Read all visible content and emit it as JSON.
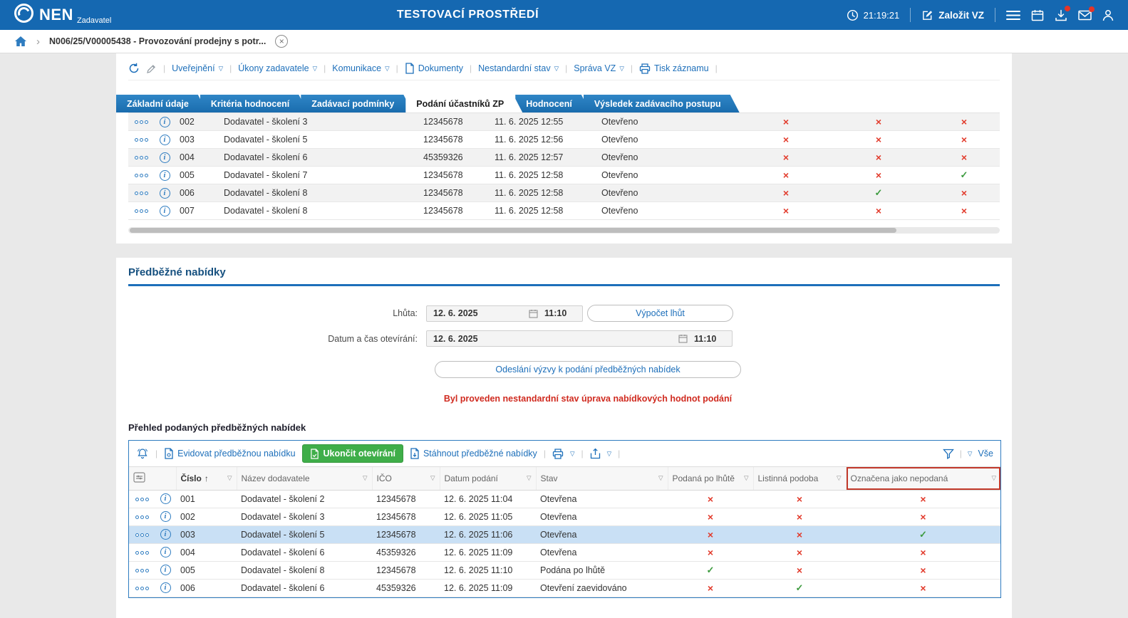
{
  "topbar": {
    "brand": "NEN",
    "brand_sub": "Zadavatel",
    "env_title": "TESTOVACÍ PROSTŘEDÍ",
    "time": "21:19:21",
    "create_vz_label": "Založit VZ"
  },
  "breadcrumb": {
    "record": "N006/25/V00005438 - Provozování prodejny s potr..."
  },
  "record_toolbar": {
    "items": [
      "Uveřejnění",
      "Úkony zadavatele",
      "Komunikace",
      "Dokumenty",
      "Nestandardní stav",
      "Správa VZ",
      "Tisk záznamu"
    ]
  },
  "tabs": [
    {
      "label": "Základní údaje",
      "active": false
    },
    {
      "label": "Kritéria hodnocení",
      "active": false
    },
    {
      "label": "Zadávací podmínky",
      "active": false
    },
    {
      "label": "Podání účastníků ZP",
      "active": true
    },
    {
      "label": "Hodnocení",
      "active": false
    },
    {
      "label": "Výsledek zadávacího postupu",
      "active": false
    }
  ],
  "participants_table": {
    "rows": [
      {
        "num": "002",
        "supplier": "Dodavatel - školení 3",
        "ico": "12345678",
        "submitted": "11. 6. 2025 12:55",
        "status": "Otevřeno",
        "flags": [
          "no",
          "no",
          "no"
        ],
        "selected": false
      },
      {
        "num": "003",
        "supplier": "Dodavatel - školení 5",
        "ico": "12345678",
        "submitted": "11. 6. 2025 12:56",
        "status": "Otevřeno",
        "flags": [
          "no",
          "no",
          "no"
        ],
        "selected": false
      },
      {
        "num": "004",
        "supplier": "Dodavatel - školení 6",
        "ico": "45359326",
        "submitted": "11. 6. 2025 12:57",
        "status": "Otevřeno",
        "flags": [
          "no",
          "no",
          "no"
        ],
        "selected": false
      },
      {
        "num": "005",
        "supplier": "Dodavatel - školení 7",
        "ico": "12345678",
        "submitted": "11. 6. 2025 12:58",
        "status": "Otevřeno",
        "flags": [
          "no",
          "no",
          "yes"
        ],
        "selected": false
      },
      {
        "num": "006",
        "supplier": "Dodavatel - školení 8",
        "ico": "12345678",
        "submitted": "11. 6. 2025 12:58",
        "status": "Otevřeno",
        "flags": [
          "no",
          "yes",
          "no"
        ],
        "selected": false
      },
      {
        "num": "007",
        "supplier": "Dodavatel - školení 8",
        "ico": "12345678",
        "submitted": "11. 6. 2025 12:58",
        "status": "Otevřeno",
        "flags": [
          "no",
          "no",
          "no"
        ],
        "selected": false
      }
    ]
  },
  "preliminary_section": {
    "title": "Předběžné nabídky",
    "deadline_label": "Lhůta:",
    "deadline_date": "12. 6. 2025",
    "deadline_time": "11:10",
    "calc_deadlines_label": "Výpočet lhůt",
    "opening_label": "Datum a čas otevírání:",
    "opening_date": "12. 6. 2025",
    "opening_time": "11:10",
    "send_invitation_label": "Odeslání výzvy k podání předběžných nabídek",
    "warning": "Byl proveden nestandardní stav úprava nabídkových hodnot podání",
    "overview_title": "Přehled podaných předběžných nabídek"
  },
  "offers_table": {
    "toolbar": {
      "register_label": "Evidovat předběžnou nabídku",
      "finish_opening_label": "Ukončit otevírání",
      "download_label": "Stáhnout předběžné nabídky",
      "all_label": "Vše"
    },
    "headers": {
      "number": "Číslo",
      "supplier": "Název dodavatele",
      "ico": "IČO",
      "submitted": "Datum podání",
      "status": "Stav",
      "late": "Podaná po lhůtě",
      "paper": "Listinná podoba",
      "not_submitted": "Označena jako nepodaná"
    },
    "rows": [
      {
        "num": "001",
        "supplier": "Dodavatel - školení 2",
        "ico": "12345678",
        "submitted": "12. 6. 2025 11:04",
        "status": "Otevřena",
        "flags": [
          "no",
          "no",
          "no"
        ],
        "selected": false
      },
      {
        "num": "002",
        "supplier": "Dodavatel - školení 3",
        "ico": "12345678",
        "submitted": "12. 6. 2025 11:05",
        "status": "Otevřena",
        "flags": [
          "no",
          "no",
          "no"
        ],
        "selected": false
      },
      {
        "num": "003",
        "supplier": "Dodavatel - školení 5",
        "ico": "12345678",
        "submitted": "12. 6. 2025 11:06",
        "status": "Otevřena",
        "flags": [
          "no",
          "no",
          "yes"
        ],
        "selected": true
      },
      {
        "num": "004",
        "supplier": "Dodavatel - školení 6",
        "ico": "45359326",
        "submitted": "12. 6. 2025 11:09",
        "status": "Otevřena",
        "flags": [
          "no",
          "no",
          "no"
        ],
        "selected": false
      },
      {
        "num": "005",
        "supplier": "Dodavatel - školení 8",
        "ico": "12345678",
        "submitted": "12. 6. 2025 11:10",
        "status": "Podána po lhůtě",
        "flags": [
          "yes",
          "no",
          "no"
        ],
        "selected": false
      },
      {
        "num": "006",
        "supplier": "Dodavatel - školení 6",
        "ico": "45359326",
        "submitted": "12. 6. 2025 11:09",
        "status": "Otevření zaevidováno",
        "flags": [
          "no",
          "yes",
          "no"
        ],
        "selected": false
      }
    ]
  },
  "icons": {
    "dropdown": "▽",
    "sort_asc": "↑",
    "breadcrumb_chevron": "›",
    "close": "×",
    "check": "✓",
    "cross": "×",
    "info": "i",
    "separator": "|"
  },
  "colors": {
    "topbar_blue": "#1568b1",
    "accent_blue": "#1d6fba",
    "green": "#3fae49",
    "warning_red": "#d02b20",
    "cross_red": "#e23b2c",
    "check_green": "#3d9b3f",
    "selected_row": "#c9e0f5"
  }
}
